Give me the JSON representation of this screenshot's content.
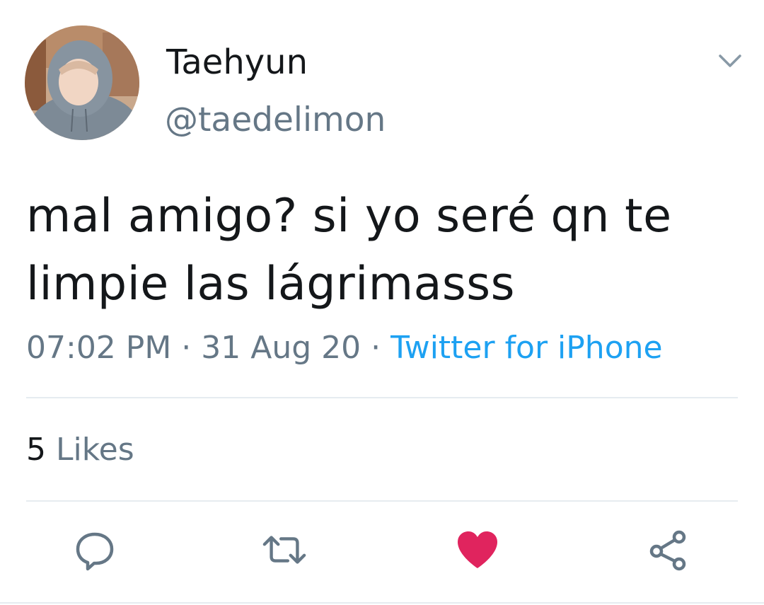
{
  "tweet": {
    "author": {
      "display_name": "Taehyun",
      "handle": "@taedelimon"
    },
    "text": "mal amigo? si yo seré qn te limpie las lágrimasss",
    "time": "07:02 PM",
    "separator": " · ",
    "date": "31 Aug 20",
    "source": "Twitter for iPhone",
    "likes_count": "5",
    "likes_label": "Likes"
  },
  "icons": {
    "menu": "chevron-down-icon",
    "reply": "reply-bubble-icon",
    "retweet": "retweet-icon",
    "like": "heart-icon",
    "share": "share-icon"
  },
  "colors": {
    "text_primary": "#14171a",
    "text_secondary": "#657786",
    "link": "#1da1f2",
    "like_active": "#e0245e",
    "divider": "#e6ecf0"
  }
}
